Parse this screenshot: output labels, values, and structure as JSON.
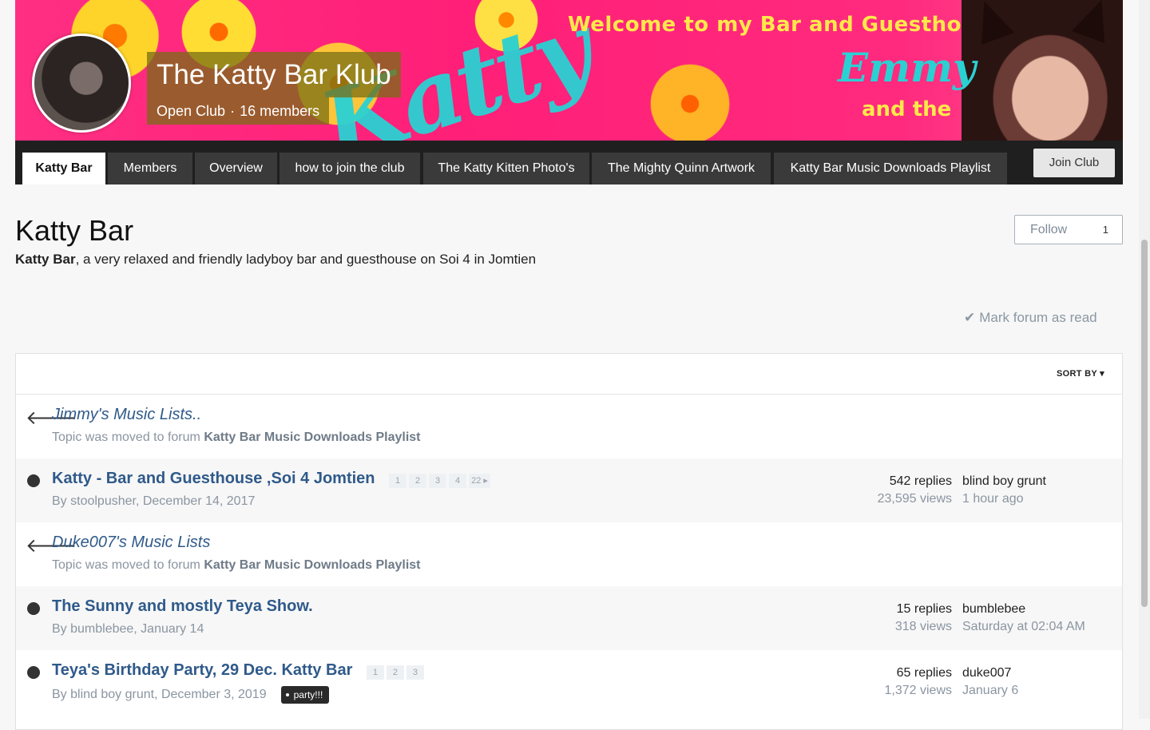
{
  "banner": {
    "welcome_text": "Welcome to my Bar and Guesthouse",
    "script_text": "Katty",
    "name_text": "Emmy",
    "and_text": "and the"
  },
  "club": {
    "name": "The Katty Bar Klub",
    "type": "Open Club",
    "separator": "·",
    "members": "16 members"
  },
  "nav": {
    "tabs": [
      {
        "label": "Katty Bar",
        "active": true
      },
      {
        "label": "Members"
      },
      {
        "label": "Overview"
      },
      {
        "label": "how to join the club"
      },
      {
        "label": "The Katty Kitten Photo's"
      },
      {
        "label": "The Mighty Quinn Artwork"
      },
      {
        "label": "Katty Bar Music Downloads Playlist"
      }
    ],
    "join_label": "Join Club"
  },
  "forum": {
    "title": "Katty Bar",
    "desc_bold": "Katty Bar",
    "desc_rest": ", a very relaxed and friendly ladyboy bar and guesthouse on Soi 4 in Jomtien",
    "follow_label": "Follow",
    "follow_count": "1",
    "mark_read": "Mark forum as read",
    "sort_label": "SORT BY ▾"
  },
  "topics": [
    {
      "title": "Jimmy's Music Lists..",
      "moved_prefix": "Topic was moved to forum",
      "moved_forum": "Katty Bar Music Downloads Playlist"
    },
    {
      "title": "Katty - Bar and Guesthouse ,Soi 4 Jomtien",
      "pages": [
        "1",
        "2",
        "3",
        "4",
        "22 ▸"
      ],
      "byline": "By stoolpusher, December 14, 2017",
      "replies": "542 replies",
      "views": "23,595 views",
      "last_user": "blind boy grunt",
      "last_time": "1 hour ago"
    },
    {
      "title": "Duke007's Music Lists",
      "moved_prefix": "Topic was moved to forum",
      "moved_forum": "Katty Bar Music Downloads Playlist"
    },
    {
      "title": "The Sunny and mostly Teya Show.",
      "byline": "By bumblebee, January 14",
      "replies": "15 replies",
      "views": "318 views",
      "last_user": "bumblebee",
      "last_time": "Saturday at 02:04 AM"
    },
    {
      "title": "Teya's Birthday Party, 29 Dec. Katty Bar",
      "pages": [
        "1",
        "2",
        "3"
      ],
      "byline": "By blind boy grunt, December 3, 2019",
      "tag": "party!!!",
      "replies": "65 replies",
      "views": "1,372 views",
      "last_user": "duke007",
      "last_time": "January 6"
    }
  ],
  "icons": {
    "check": "✔",
    "arrow_left": "🡐",
    "unread_dot": "●"
  }
}
